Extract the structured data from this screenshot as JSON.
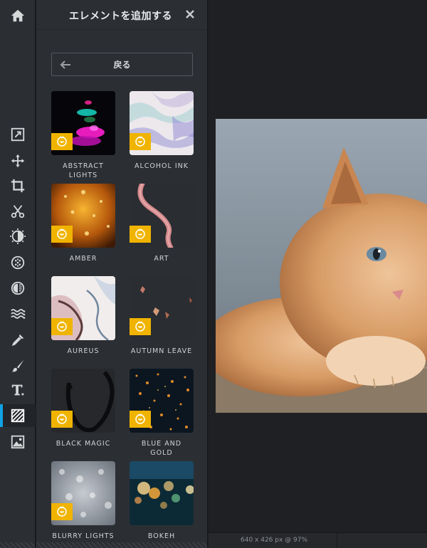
{
  "panel": {
    "title": "エレメントを追加する",
    "back_label": "戻る"
  },
  "toolbar": {
    "tools": [
      "home-icon",
      "resize-icon",
      "move-icon",
      "crop-icon",
      "cut-icon",
      "adjust-icon",
      "effects-icon",
      "vignette-icon",
      "wave-icon",
      "dropper-icon",
      "brush-icon",
      "text-icon",
      "pattern-icon",
      "image-icon"
    ],
    "active_tool": "pattern-icon"
  },
  "elements": [
    {
      "label": "ABSTRACT\nLIGHTS"
    },
    {
      "label": "ALCOHOL INK"
    },
    {
      "label": "AMBER"
    },
    {
      "label": "ART"
    },
    {
      "label": "AUREUS"
    },
    {
      "label": "AUTUMN LEAVE"
    },
    {
      "label": "BLACK MAGIC"
    },
    {
      "label": "BLUE AND\nGOLD"
    },
    {
      "label": "BLURRY LIGHTS"
    },
    {
      "label": "BOKEH"
    }
  ],
  "status": {
    "image_info": "640 x 426 px @ 97%"
  },
  "colors": {
    "accent": "#10a2e4",
    "premium_badge": "#f0b400"
  }
}
